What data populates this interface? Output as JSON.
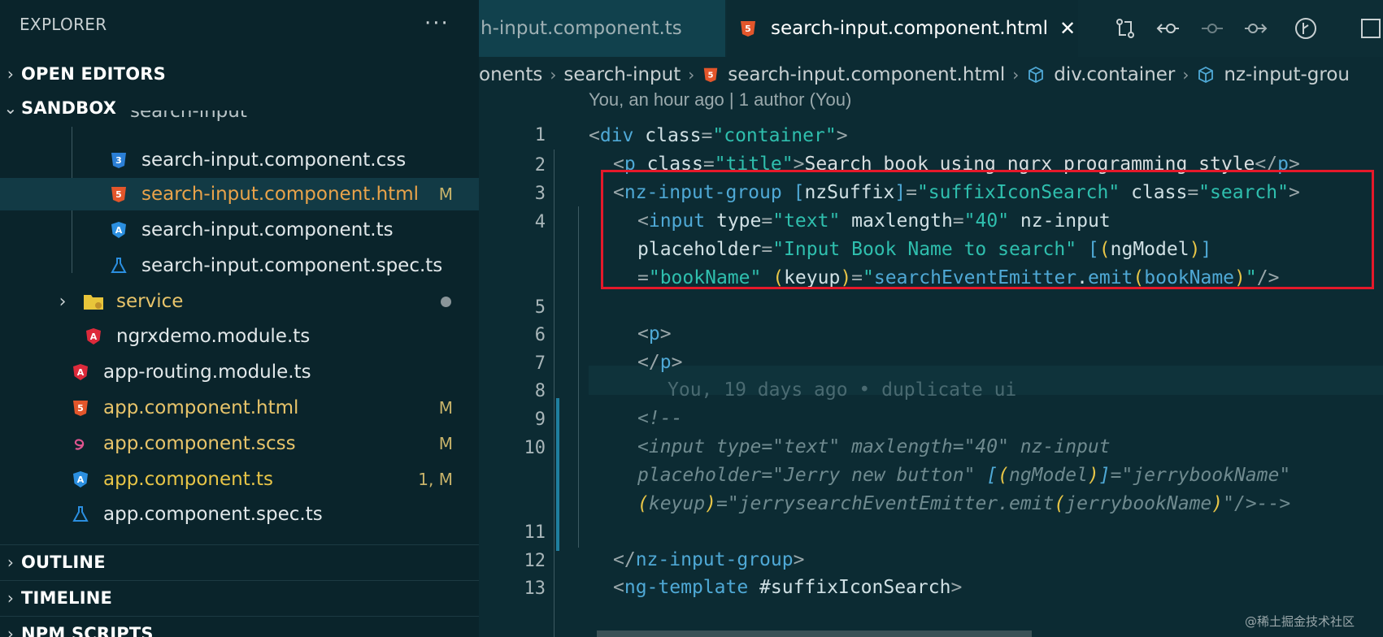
{
  "sidebar": {
    "explorer_title": "EXPLORER",
    "more_label": "···",
    "open_editors": "OPEN EDITORS",
    "sandbox": "SANDBOX",
    "folder_partial": "search-input",
    "items": [
      {
        "label": "search-input.component.css",
        "badge": ""
      },
      {
        "label": "search-input.component.html",
        "badge": "M"
      },
      {
        "label": "search-input.component.ts",
        "badge": ""
      },
      {
        "label": "search-input.component.spec.ts",
        "badge": ""
      },
      {
        "label": "service",
        "badge": ""
      },
      {
        "label": "ngrxdemo.module.ts",
        "badge": ""
      },
      {
        "label": "app-routing.module.ts",
        "badge": ""
      },
      {
        "label": "app.component.html",
        "badge": "M"
      },
      {
        "label": "app.component.scss",
        "badge": "M"
      },
      {
        "label": "app.component.ts",
        "badge": "1, M"
      },
      {
        "label": "app.component.spec.ts",
        "badge": ""
      }
    ],
    "outline": "OUTLINE",
    "timeline": "TIMELINE",
    "npm_scripts": "NPM SCRIPTS"
  },
  "tabs": [
    {
      "label": "h-input.component.ts"
    },
    {
      "label": "search-input.component.html",
      "close": "✕"
    }
  ],
  "breadcrumb": [
    "onents",
    "search-input",
    "search-input.component.html",
    "div.container",
    "nz-input-grou"
  ],
  "editor": {
    "blame_header": "You, an hour ago | 1 author (You)",
    "inline_blame": "You, 19 days ago • duplicate ui",
    "line_numbers": [
      "1",
      "2",
      "3",
      "4",
      "5",
      "6",
      "7",
      "8",
      "9",
      "10",
      "11",
      "12",
      "13"
    ]
  },
  "watermark": "@稀土掘金技术社区",
  "colors": {
    "accent_red": "#e5192a",
    "tag_blue": "#4fa9d6",
    "string_teal": "#2fbfae",
    "modified_badge": "#c8b36a"
  }
}
